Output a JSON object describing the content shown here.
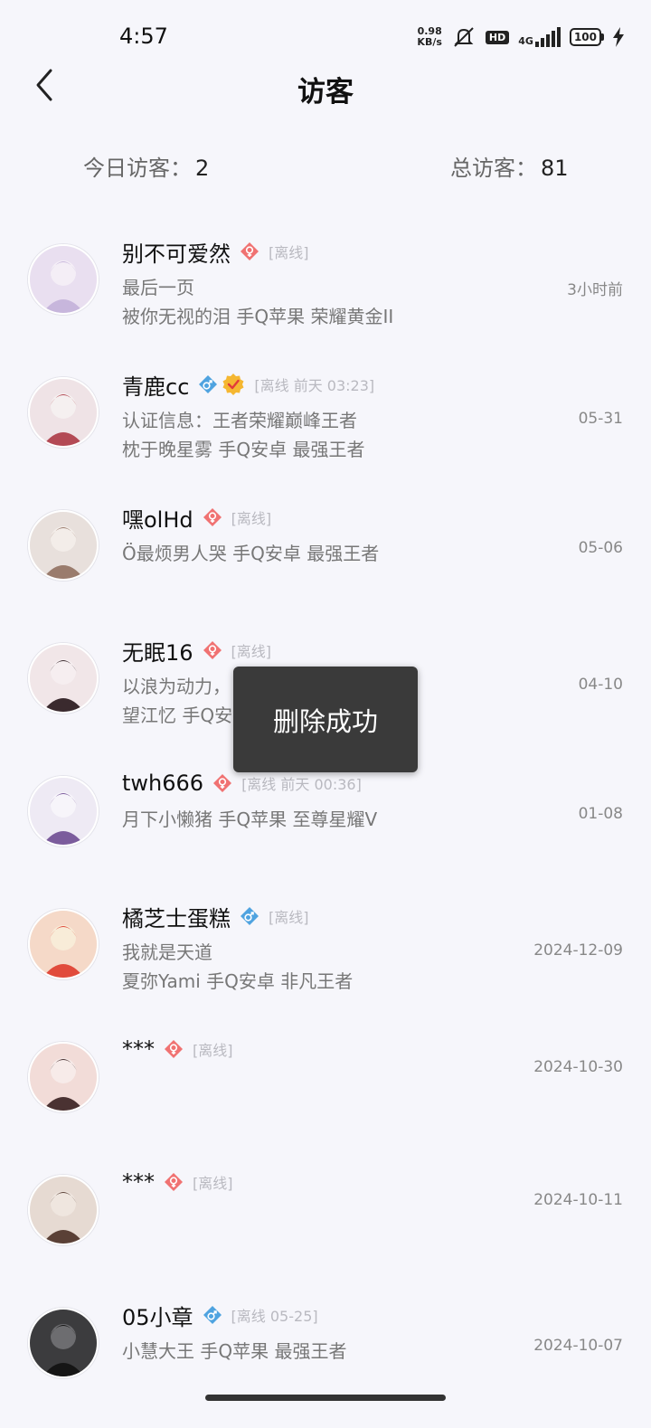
{
  "status_bar": {
    "time": "4:57",
    "net_speed_value": "0.98",
    "net_speed_unit": "KB/s",
    "hd": "HD",
    "network": "4G",
    "battery": "100"
  },
  "header": {
    "title": "访客"
  },
  "stats": {
    "today_label": "今日访客：",
    "today_value": "2",
    "total_label": "总访客：",
    "total_value": "81"
  },
  "visitors": [
    {
      "name": "别不可爱然",
      "gender": "female",
      "status": "[离线]",
      "line1": "最后一页",
      "line2": "被你无视的泪 手Q苹果 荣耀黄金II",
      "time": "3小时前"
    },
    {
      "name": "青鹿cc",
      "gender": "male",
      "certified": true,
      "status": "[离线 前天 03:23]",
      "line1": "认证信息：王者荣耀巅峰王者",
      "line2": "枕于晚星雾 手Q安卓 最强王者",
      "time": "05-31"
    },
    {
      "name": "嘿olHd",
      "gender": "female",
      "status": "[离线]",
      "line1": "Ö最烦男人哭 手Q安卓 最强王者",
      "line2": "",
      "time": "05-06"
    },
    {
      "name": "无眠16",
      "gender": "female",
      "status": "[离线]",
      "line1": "以浪为动力，",
      "line2": "望江忆 手Q安",
      "time": "04-10"
    },
    {
      "name": "twh666",
      "gender": "female",
      "status": "[离线 前天 00:36]",
      "line1": "月下小懒猪 手Q苹果 至尊星耀V",
      "line2": "",
      "time": "01-08"
    },
    {
      "name": "橘芝士蛋糕",
      "gender": "male",
      "status": "[离线]",
      "line1": "我就是天道",
      "line2": "夏弥Yami 手Q安卓 非凡王者",
      "time": "2024-12-09"
    },
    {
      "name": "***",
      "gender": "female",
      "status": "[离线]",
      "line1": "",
      "line2": "",
      "time": "2024-10-30"
    },
    {
      "name": "***",
      "gender": "female",
      "status": "[离线]",
      "line1": "",
      "line2": "",
      "time": "2024-10-11"
    },
    {
      "name": "05小章",
      "gender": "male",
      "status": "[离线 05-25]",
      "line1": "小慧大王 手Q苹果 最强王者",
      "line2": "",
      "time": "2024-10-07"
    }
  ],
  "toast": {
    "message": "删除成功"
  },
  "colors": {
    "female": "#f07272",
    "male": "#4fa3e0",
    "background": "#f6f6fb",
    "toast": "#3a3a3a"
  }
}
